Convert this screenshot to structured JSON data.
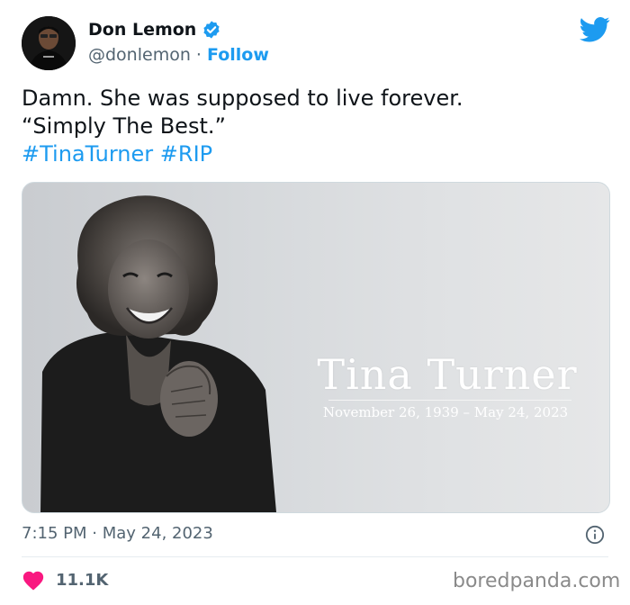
{
  "author": {
    "name": "Don Lemon",
    "handle": "@donlemon",
    "separator": "·",
    "follow_label": "Follow"
  },
  "tweet": {
    "line1": "Damn. She was supposed to live forever.",
    "line2": "“Simply The Best.”",
    "hashtags": [
      "#TinaTurner",
      "#RIP"
    ]
  },
  "media": {
    "title": "Tina Turner",
    "dates": "November 26, 1939 – May 24, 2023"
  },
  "meta": {
    "time": "7:15 PM",
    "separator": "·",
    "date": "May 24, 2023"
  },
  "engagement": {
    "likes": "11.1K"
  },
  "watermark": "boredpanda.com",
  "colors": {
    "accent": "#1d9bf0",
    "heart": "#f91880",
    "text": "#0f1419",
    "secondary": "#536471"
  },
  "icons": [
    "verified-badge-icon",
    "twitter-bird-icon",
    "info-icon",
    "heart-icon"
  ]
}
